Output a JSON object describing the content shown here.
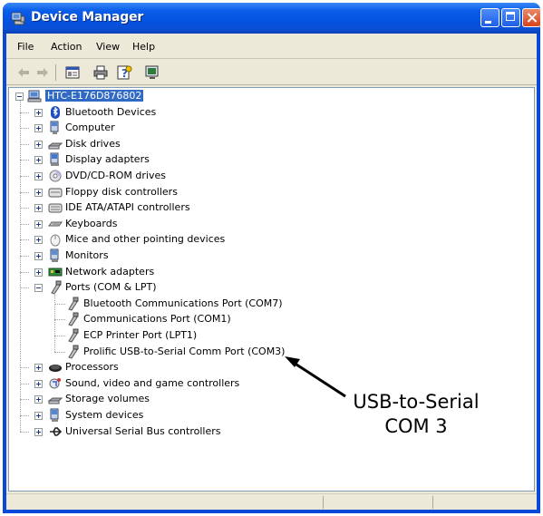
{
  "window": {
    "title": "Device Manager",
    "colors": {
      "title_blue": "#0553e1",
      "selection": "#316ac5",
      "close_red": "#d7421c"
    }
  },
  "menu": [
    "File",
    "Action",
    "View",
    "Help"
  ],
  "toolbar": [
    "back-icon",
    "forward-icon",
    "properties-icon",
    "print-icon",
    "help-icon",
    "scan-hardware-icon"
  ],
  "tree": {
    "root": "HTC-E176D876802",
    "items": [
      {
        "label": "Bluetooth Devices",
        "icon": "bluetooth-icon"
      },
      {
        "label": "Computer",
        "icon": "computer-icon"
      },
      {
        "label": "Disk drives",
        "icon": "disk-drive-icon"
      },
      {
        "label": "Display adapters",
        "icon": "display-adapter-icon"
      },
      {
        "label": "DVD/CD-ROM drives",
        "icon": "cdrom-icon"
      },
      {
        "label": "Floppy disk controllers",
        "icon": "floppy-controller-icon"
      },
      {
        "label": "IDE ATA/ATAPI controllers",
        "icon": "ide-controller-icon"
      },
      {
        "label": "Keyboards",
        "icon": "keyboard-icon"
      },
      {
        "label": "Mice and other pointing devices",
        "icon": "mouse-icon"
      },
      {
        "label": "Monitors",
        "icon": "monitor-icon"
      },
      {
        "label": "Network adapters",
        "icon": "network-adapter-icon"
      },
      {
        "label": "Ports (COM & LPT)",
        "icon": "port-icon",
        "expanded": true,
        "children": [
          "Bluetooth Communications Port (COM7)",
          "Communications Port (COM1)",
          "ECP Printer Port (LPT1)",
          "Prolific USB-to-Serial Comm Port (COM3)"
        ]
      },
      {
        "label": "Processors",
        "icon": "processor-icon"
      },
      {
        "label": "Sound, video and game controllers",
        "icon": "sound-icon"
      },
      {
        "label": "Storage volumes",
        "icon": "storage-volume-icon"
      },
      {
        "label": "System devices",
        "icon": "system-device-icon"
      },
      {
        "label": "Universal Serial Bus controllers",
        "icon": "usb-icon"
      }
    ]
  },
  "annotation": {
    "line1": "USB-to-Serial",
    "line2": "COM 3"
  }
}
